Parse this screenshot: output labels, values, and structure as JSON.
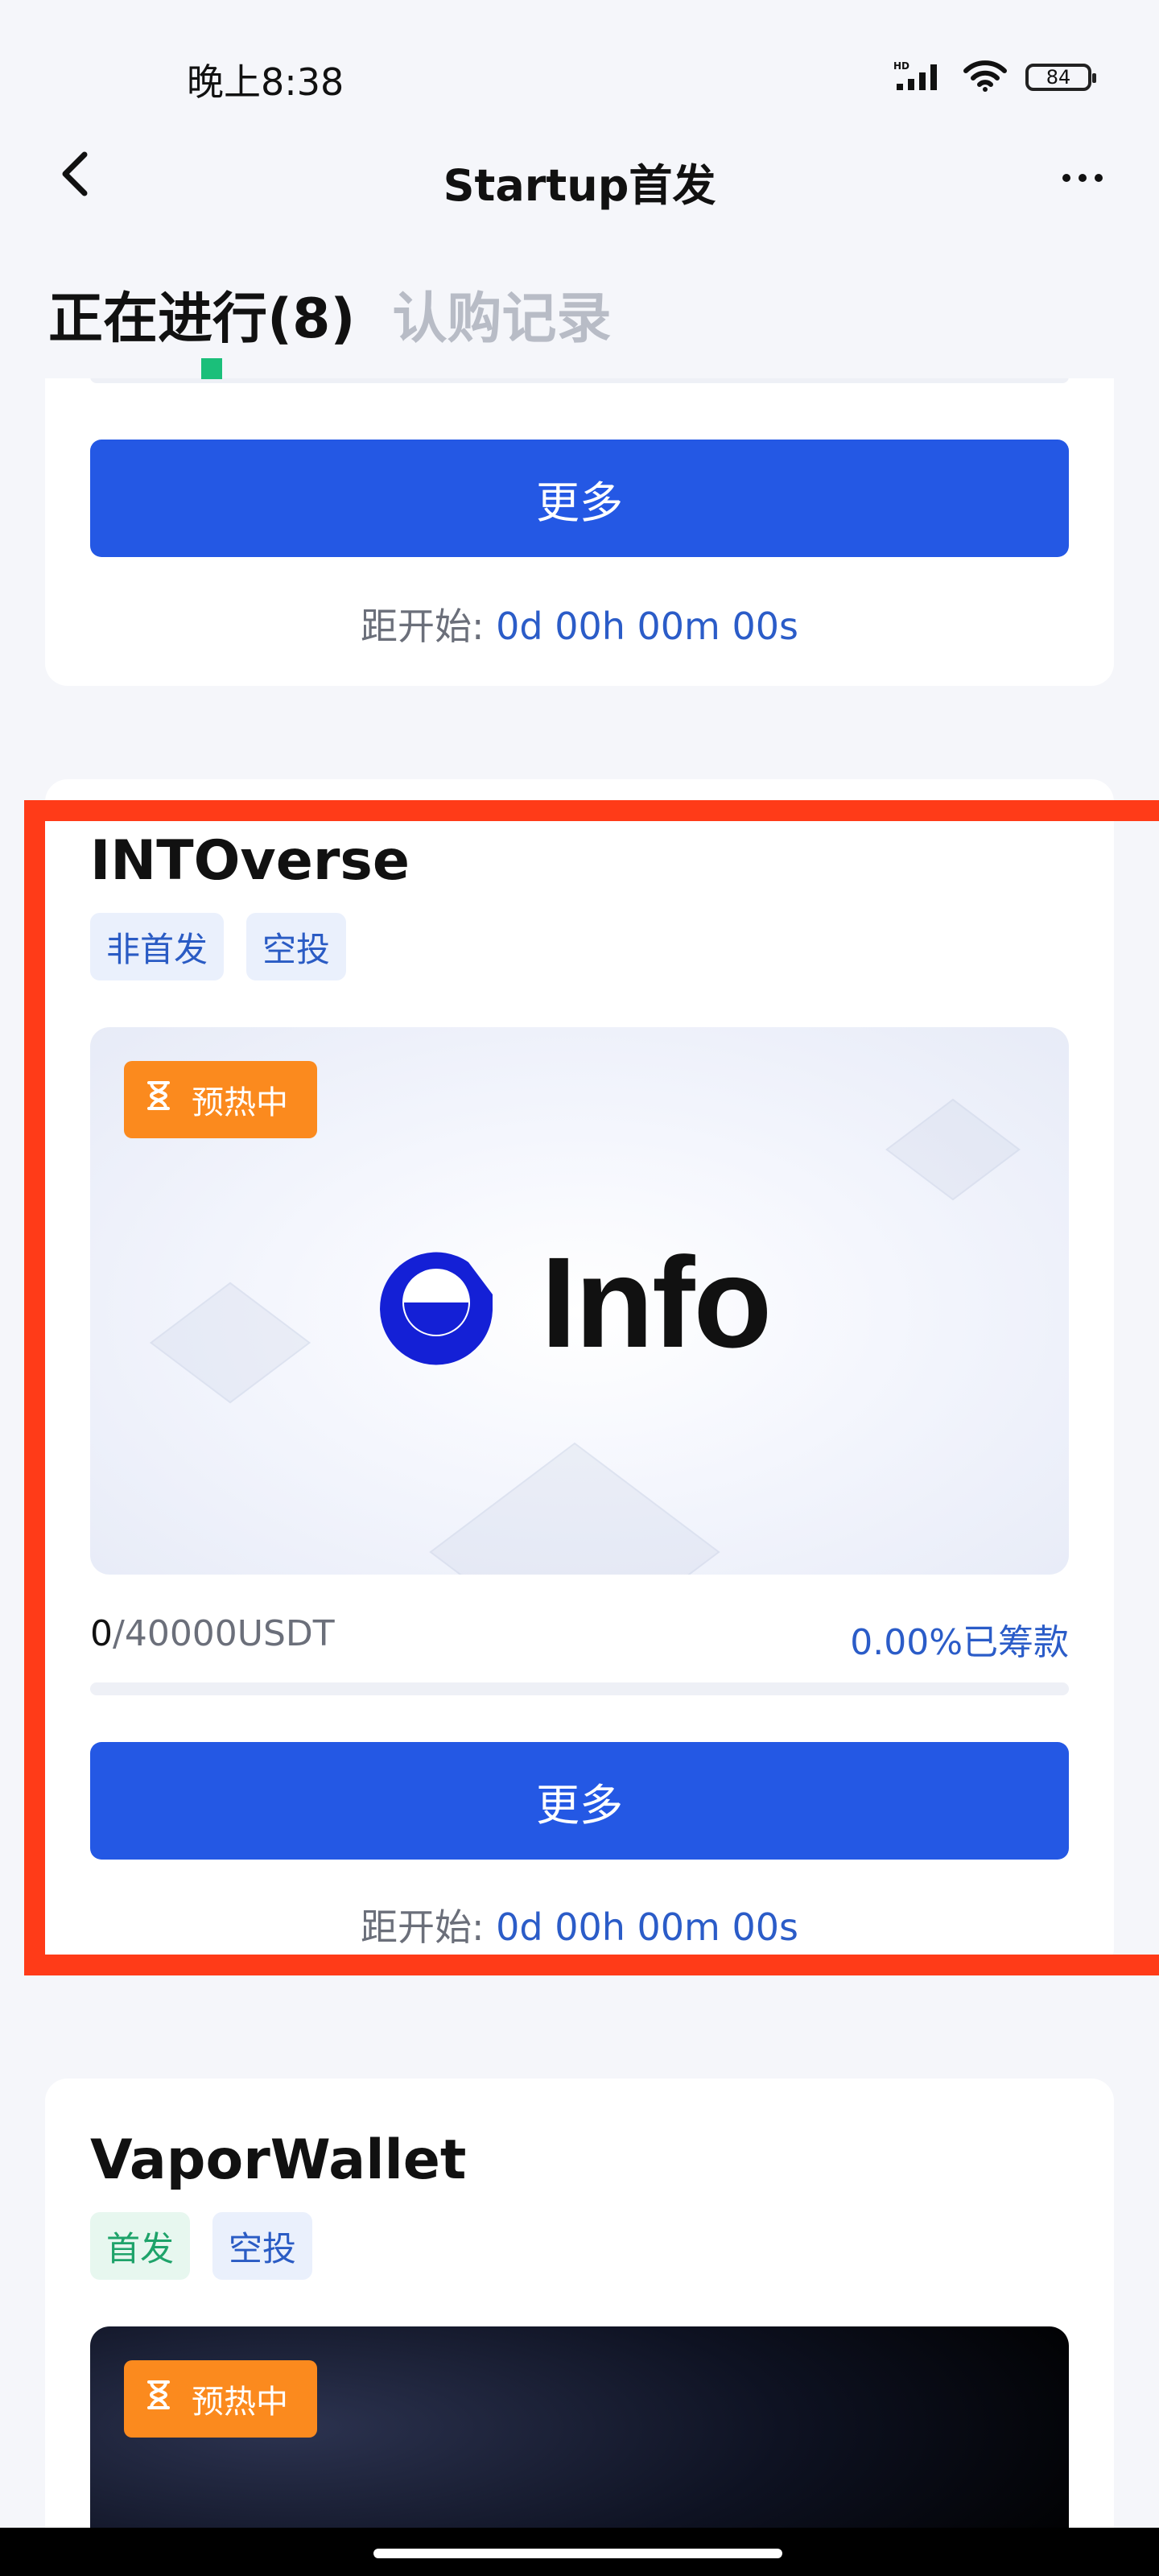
{
  "status_bar": {
    "time": "晚上8:38",
    "battery": "84",
    "icons": [
      "hd-signal-icon",
      "wifi-icon",
      "battery-icon"
    ]
  },
  "nav": {
    "title": "Startup首发",
    "back_icon": "chevron-left-icon",
    "more_icon": "more-dots-icon"
  },
  "tabs": [
    {
      "label": "正在进行(8)",
      "active": true
    },
    {
      "label": "认购记录",
      "active": false
    }
  ],
  "colors": {
    "accent": "#2458e4",
    "indicator": "#1bbf7a",
    "badge": "#fb8a1e",
    "highlight": "#ff3b18"
  },
  "cards": [
    {
      "button": "更多",
      "countdown_label": "距开始:",
      "countdown_value": "0d 00h 00m 00s",
      "progress": 0
    },
    {
      "title": "INTOverse",
      "tags": [
        {
          "label": "非首发",
          "style": "blue"
        },
        {
          "label": "空投",
          "style": "blue"
        }
      ],
      "badge": "预热中",
      "badge_icon": "hourglass-icon",
      "banner_logo": "Info",
      "raised": "0",
      "goal": "/40000USDT",
      "percent": "0.00%已筹款",
      "progress": 0,
      "button": "更多",
      "countdown_label": "距开始:",
      "countdown_value": "0d 00h 00m 00s"
    },
    {
      "title": "VaporWallet",
      "tags": [
        {
          "label": "首发",
          "style": "green"
        },
        {
          "label": "空投",
          "style": "blue"
        }
      ],
      "badge": "预热中",
      "badge_icon": "hourglass-icon"
    }
  ]
}
